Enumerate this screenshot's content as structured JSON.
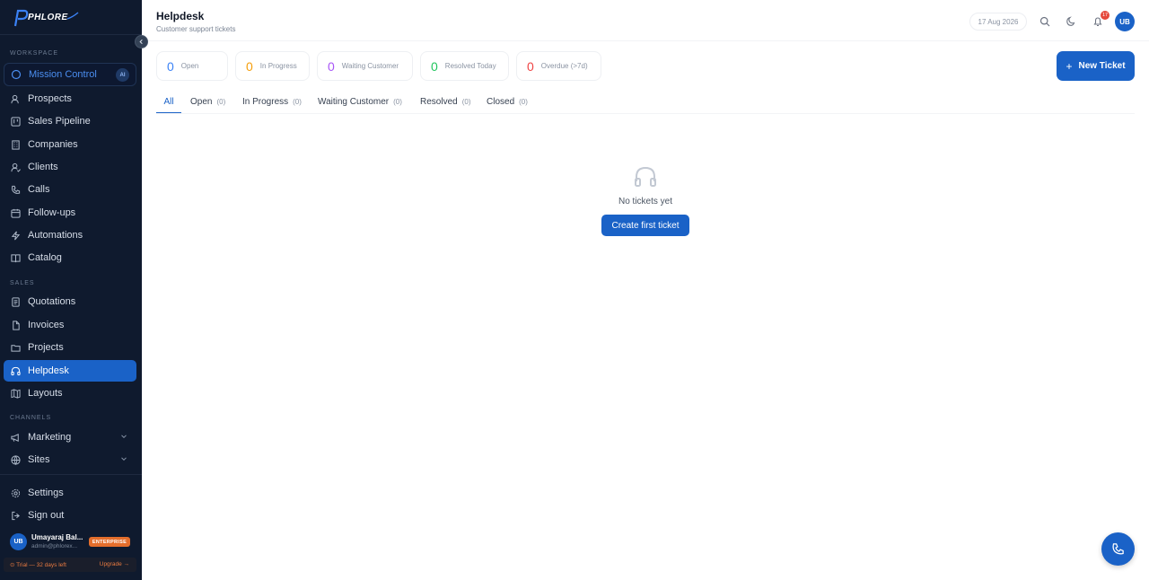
{
  "brand": {
    "name": "PHLORE"
  },
  "sidebar": {
    "workspace_label": "WORKSPACE",
    "mission": {
      "label": "Mission Control",
      "badge": "AI"
    },
    "workspace_items": [
      {
        "label": "Prospects"
      },
      {
        "label": "Sales Pipeline"
      },
      {
        "label": "Companies"
      },
      {
        "label": "Clients"
      },
      {
        "label": "Calls"
      },
      {
        "label": "Follow-ups"
      },
      {
        "label": "Automations"
      },
      {
        "label": "Catalog"
      }
    ],
    "sales_label": "SALES",
    "sales_items": [
      {
        "label": "Quotations"
      },
      {
        "label": "Invoices"
      },
      {
        "label": "Projects"
      },
      {
        "label": "Helpdesk"
      },
      {
        "label": "Layouts"
      }
    ],
    "channels_label": "CHANNELS",
    "channel_items": [
      {
        "label": "Marketing"
      },
      {
        "label": "Sites"
      }
    ],
    "bottom_items": [
      {
        "label": "Settings"
      },
      {
        "label": "Sign out"
      }
    ],
    "user": {
      "initials": "UB",
      "name": "Umayaraj Bal...",
      "email": "admin@phlorex...",
      "plan": "ENTERPRISE"
    },
    "trial": {
      "text": "⊙ Trial — 32 days left",
      "upgrade": "Upgrade →"
    }
  },
  "header": {
    "title": "Helpdesk",
    "subtitle": "Customer support tickets",
    "date": "17 Aug 2026",
    "notifications": "17",
    "avatar": "UB"
  },
  "stats": [
    {
      "value": "0",
      "label": "Open",
      "color": "#3b82f6"
    },
    {
      "value": "0",
      "label": "In Progress",
      "color": "#f59e0b"
    },
    {
      "value": "0",
      "label": "Waiting Customer",
      "color": "#a855f7"
    },
    {
      "value": "0",
      "label": "Resolved Today",
      "color": "#22c55e"
    },
    {
      "value": "0",
      "label": "Overdue (>7d)",
      "color": "#ef4444"
    }
  ],
  "new_ticket_label": "New Ticket",
  "tabs": [
    {
      "label": "All",
      "count": ""
    },
    {
      "label": "Open",
      "count": "(0)"
    },
    {
      "label": "In Progress",
      "count": "(0)"
    },
    {
      "label": "Waiting Customer",
      "count": "(0)"
    },
    {
      "label": "Resolved",
      "count": "(0)"
    },
    {
      "label": "Closed",
      "count": "(0)"
    }
  ],
  "empty": {
    "message": "No tickets yet",
    "cta": "Create first ticket"
  },
  "colors": {
    "accent": "#1a62c7",
    "sidebar_bg": "#0f1a2e"
  }
}
